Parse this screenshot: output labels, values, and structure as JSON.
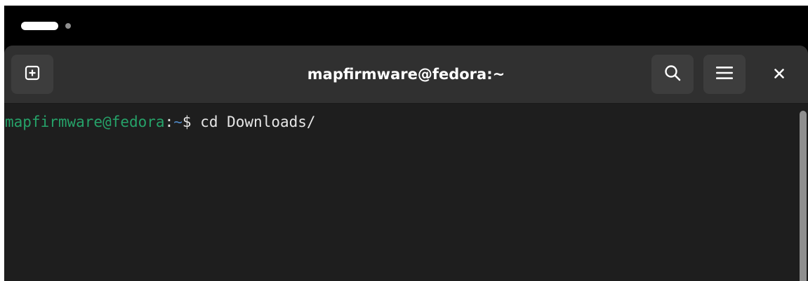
{
  "window": {
    "title": "mapfirmware@fedora:~"
  },
  "headerbar": {
    "new_tab_icon": "new-tab-icon",
    "search_icon": "search-icon",
    "menu_icon": "hamburger-menu-icon",
    "close_icon": "close-icon"
  },
  "terminal": {
    "prompt_user_host": "mapfirmware@fedora",
    "prompt_sep": ":",
    "prompt_path": "~",
    "prompt_symbol": "$",
    "command": " cd Downloads/"
  },
  "colors": {
    "prompt_user": "#26a269",
    "prompt_path": "#4f87c2",
    "background": "#1e1e1e",
    "headerbar": "#303030"
  }
}
